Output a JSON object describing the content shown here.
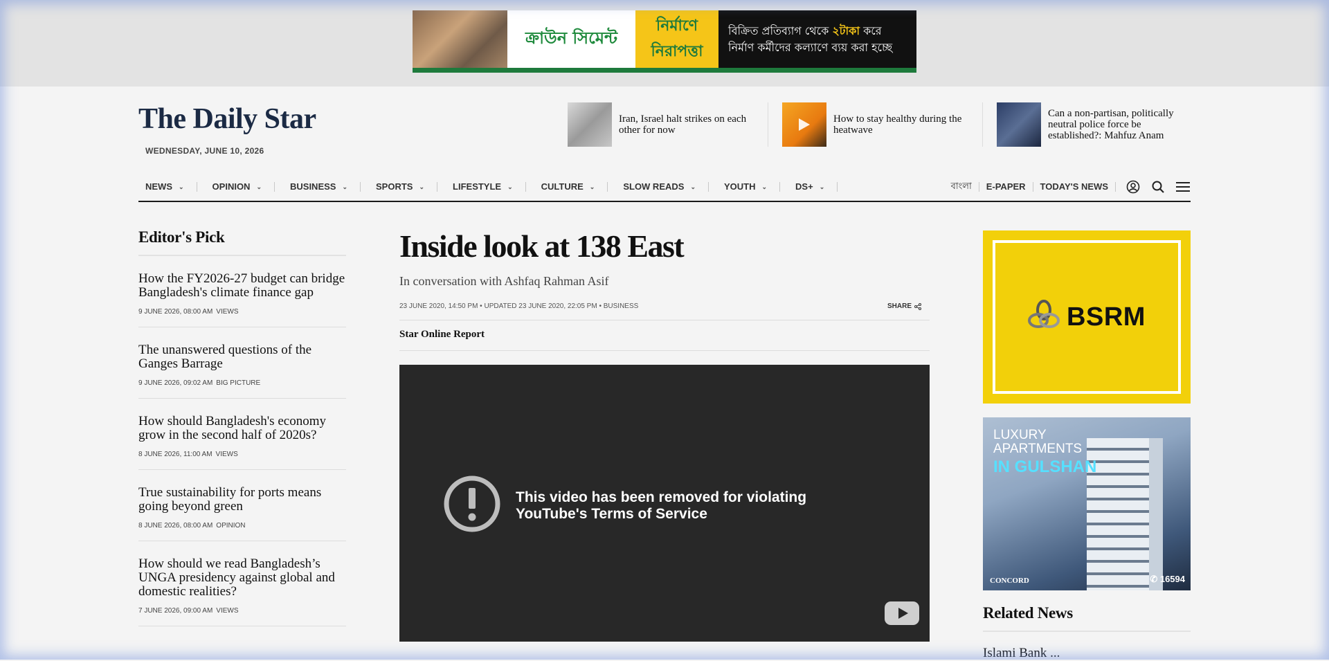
{
  "top_ad": {
    "brand": "ক্রাউন সিমেন্ট",
    "tagline": "নির্মাণে নিরাপত্তা",
    "message_line1_prefix": "বিক্রিত প্রতিব্যাগ থেকে ",
    "message_highlight": "২টাকা",
    "message_line1_suffix": " করে",
    "message_line2": "নির্মাণ কর্মীদের কল্যাণে ব্যয় করা হচ্ছে"
  },
  "header": {
    "logo": "The Daily Star",
    "date": "WEDNESDAY, JUNE 10, 2026",
    "top_stories": [
      {
        "title": "Iran, Israel halt strikes on each other for now"
      },
      {
        "title": "How to stay healthy during the heatwave"
      },
      {
        "title": "Can a non-partisan, politically neutral police force be established?: Mahfuz Anam"
      }
    ]
  },
  "nav": {
    "items": [
      "NEWS",
      "OPINION",
      "BUSINESS",
      "SPORTS",
      "LIFESTYLE",
      "CULTURE",
      "SLOW READS",
      "YOUTH",
      "DS+"
    ],
    "right_links": [
      "বাংলা",
      "E-PAPER",
      "TODAY'S NEWS"
    ]
  },
  "editors_pick": {
    "title": "Editor's Pick",
    "items": [
      {
        "headline": "How the FY2026-27 budget can bridge Bangladesh's climate finance gap",
        "date": "9 JUNE 2026, 08:00 AM",
        "category": "VIEWS"
      },
      {
        "headline": "The unanswered questions of the Ganges Barrage",
        "date": "9 JUNE 2026, 09:02 AM",
        "category": "BIG PICTURE"
      },
      {
        "headline": "How should Bangladesh's economy grow in the second half of 2020s?",
        "date": "8 JUNE 2026, 11:00 AM",
        "category": "VIEWS"
      },
      {
        "headline": "True sustainability for ports means going beyond green",
        "date": "8 JUNE 2026, 08:00 AM",
        "category": "OPINION"
      },
      {
        "headline": "How should we read Bangladesh’s UNGA presidency against global and domestic realities?",
        "date": "7 JUNE 2026, 09:00 AM",
        "category": "VIEWS"
      }
    ]
  },
  "article": {
    "headline": "Inside look at 138 East",
    "subhead": "In conversation with Ashfaq Rahman Asif",
    "published": "23 JUNE 2020, 14:50 PM",
    "updated": "UPDATED 23 JUNE 2020, 22:05 PM",
    "category": "BUSINESS",
    "share_label": "SHARE",
    "byline": "Star Online Report",
    "video_error": "This video has been removed for violating YouTube's Terms of Service"
  },
  "sidebar": {
    "ad1_text": "BSRM",
    "ad2_line1": "LUXURY",
    "ad2_line2": "APARTMENTS",
    "ad2_highlight": "IN GULSHAN",
    "ad2_brand": "CONCORD",
    "ad2_phone": "16594",
    "related_title": "Related News",
    "related_first": "Islami Bank ..."
  }
}
